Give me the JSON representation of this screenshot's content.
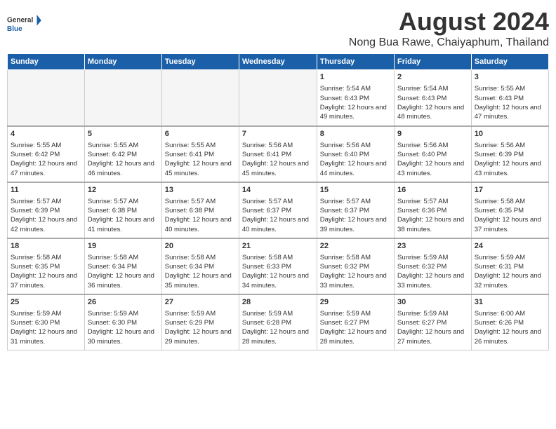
{
  "logo": {
    "text_general": "General",
    "text_blue": "Blue"
  },
  "title": "August 2024",
  "subtitle": "Nong Bua Rawe, Chaiyaphum, Thailand",
  "days_of_week": [
    "Sunday",
    "Monday",
    "Tuesday",
    "Wednesday",
    "Thursday",
    "Friday",
    "Saturday"
  ],
  "weeks": [
    [
      {
        "day": "",
        "empty": true
      },
      {
        "day": "",
        "empty": true
      },
      {
        "day": "",
        "empty": true
      },
      {
        "day": "",
        "empty": true
      },
      {
        "day": "1",
        "sunrise": "5:54 AM",
        "sunset": "6:43 PM",
        "daylight": "12 hours and 49 minutes."
      },
      {
        "day": "2",
        "sunrise": "5:54 AM",
        "sunset": "6:43 PM",
        "daylight": "12 hours and 48 minutes."
      },
      {
        "day": "3",
        "sunrise": "5:55 AM",
        "sunset": "6:43 PM",
        "daylight": "12 hours and 47 minutes."
      }
    ],
    [
      {
        "day": "4",
        "sunrise": "5:55 AM",
        "sunset": "6:42 PM",
        "daylight": "12 hours and 47 minutes."
      },
      {
        "day": "5",
        "sunrise": "5:55 AM",
        "sunset": "6:42 PM",
        "daylight": "12 hours and 46 minutes."
      },
      {
        "day": "6",
        "sunrise": "5:55 AM",
        "sunset": "6:41 PM",
        "daylight": "12 hours and 45 minutes."
      },
      {
        "day": "7",
        "sunrise": "5:56 AM",
        "sunset": "6:41 PM",
        "daylight": "12 hours and 45 minutes."
      },
      {
        "day": "8",
        "sunrise": "5:56 AM",
        "sunset": "6:40 PM",
        "daylight": "12 hours and 44 minutes."
      },
      {
        "day": "9",
        "sunrise": "5:56 AM",
        "sunset": "6:40 PM",
        "daylight": "12 hours and 43 minutes."
      },
      {
        "day": "10",
        "sunrise": "5:56 AM",
        "sunset": "6:39 PM",
        "daylight": "12 hours and 43 minutes."
      }
    ],
    [
      {
        "day": "11",
        "sunrise": "5:57 AM",
        "sunset": "6:39 PM",
        "daylight": "12 hours and 42 minutes."
      },
      {
        "day": "12",
        "sunrise": "5:57 AM",
        "sunset": "6:38 PM",
        "daylight": "12 hours and 41 minutes."
      },
      {
        "day": "13",
        "sunrise": "5:57 AM",
        "sunset": "6:38 PM",
        "daylight": "12 hours and 40 minutes."
      },
      {
        "day": "14",
        "sunrise": "5:57 AM",
        "sunset": "6:37 PM",
        "daylight": "12 hours and 40 minutes."
      },
      {
        "day": "15",
        "sunrise": "5:57 AM",
        "sunset": "6:37 PM",
        "daylight": "12 hours and 39 minutes."
      },
      {
        "day": "16",
        "sunrise": "5:57 AM",
        "sunset": "6:36 PM",
        "daylight": "12 hours and 38 minutes."
      },
      {
        "day": "17",
        "sunrise": "5:58 AM",
        "sunset": "6:35 PM",
        "daylight": "12 hours and 37 minutes."
      }
    ],
    [
      {
        "day": "18",
        "sunrise": "5:58 AM",
        "sunset": "6:35 PM",
        "daylight": "12 hours and 37 minutes."
      },
      {
        "day": "19",
        "sunrise": "5:58 AM",
        "sunset": "6:34 PM",
        "daylight": "12 hours and 36 minutes."
      },
      {
        "day": "20",
        "sunrise": "5:58 AM",
        "sunset": "6:34 PM",
        "daylight": "12 hours and 35 minutes."
      },
      {
        "day": "21",
        "sunrise": "5:58 AM",
        "sunset": "6:33 PM",
        "daylight": "12 hours and 34 minutes."
      },
      {
        "day": "22",
        "sunrise": "5:58 AM",
        "sunset": "6:32 PM",
        "daylight": "12 hours and 33 minutes."
      },
      {
        "day": "23",
        "sunrise": "5:59 AM",
        "sunset": "6:32 PM",
        "daylight": "12 hours and 33 minutes."
      },
      {
        "day": "24",
        "sunrise": "5:59 AM",
        "sunset": "6:31 PM",
        "daylight": "12 hours and 32 minutes."
      }
    ],
    [
      {
        "day": "25",
        "sunrise": "5:59 AM",
        "sunset": "6:30 PM",
        "daylight": "12 hours and 31 minutes."
      },
      {
        "day": "26",
        "sunrise": "5:59 AM",
        "sunset": "6:30 PM",
        "daylight": "12 hours and 30 minutes."
      },
      {
        "day": "27",
        "sunrise": "5:59 AM",
        "sunset": "6:29 PM",
        "daylight": "12 hours and 29 minutes."
      },
      {
        "day": "28",
        "sunrise": "5:59 AM",
        "sunset": "6:28 PM",
        "daylight": "12 hours and 28 minutes."
      },
      {
        "day": "29",
        "sunrise": "5:59 AM",
        "sunset": "6:27 PM",
        "daylight": "12 hours and 28 minutes."
      },
      {
        "day": "30",
        "sunrise": "5:59 AM",
        "sunset": "6:27 PM",
        "daylight": "12 hours and 27 minutes."
      },
      {
        "day": "31",
        "sunrise": "6:00 AM",
        "sunset": "6:26 PM",
        "daylight": "12 hours and 26 minutes."
      }
    ]
  ]
}
